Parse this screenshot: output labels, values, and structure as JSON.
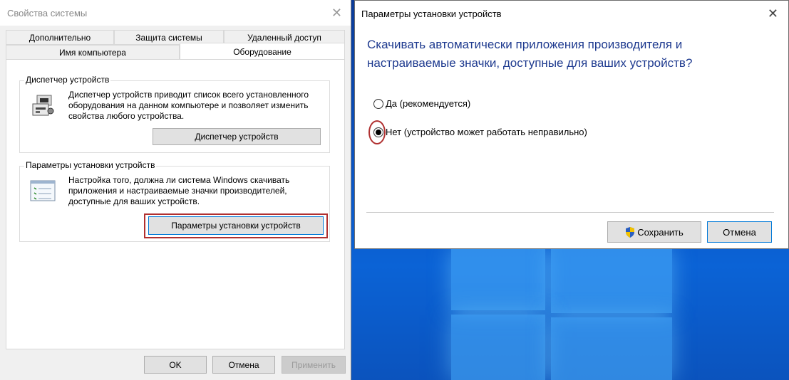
{
  "system_properties": {
    "title": "Свойства системы",
    "tabs": {
      "additional": "Дополнительно",
      "protection": "Защита системы",
      "remote": "Удаленный доступ",
      "computer_name": "Имя компьютера",
      "hardware": "Оборудование"
    },
    "device_manager": {
      "group_title": "Диспетчер устройств",
      "description": "Диспетчер устройств приводит список всего установленного оборудования на данном компьютере и позволяет изменить свойства любого устройства.",
      "button": "Диспетчер устройств"
    },
    "device_install": {
      "group_title": "Параметры установки устройств",
      "description": "Настройка того, должна ли система Windows скачивать приложения и настраиваемые значки производителей, доступные для ваших устройств.",
      "button": "Параметры установки устройств"
    },
    "buttons": {
      "ok": "OK",
      "cancel": "Отмена",
      "apply": "Применить"
    }
  },
  "device_install_dialog": {
    "title": "Параметры установки устройств",
    "question": "Скачивать автоматически приложения производителя и настраиваемые значки, доступные для ваших устройств?",
    "options": {
      "yes": "Да (рекомендуется)",
      "no": "Нет (устройство может работать неправильно)"
    },
    "selected": "no",
    "buttons": {
      "save": "Сохранить",
      "cancel": "Отмена"
    }
  },
  "colors": {
    "highlight": "#b03030",
    "question_text": "#1e3a8f",
    "desktop": "#0b55c4"
  }
}
